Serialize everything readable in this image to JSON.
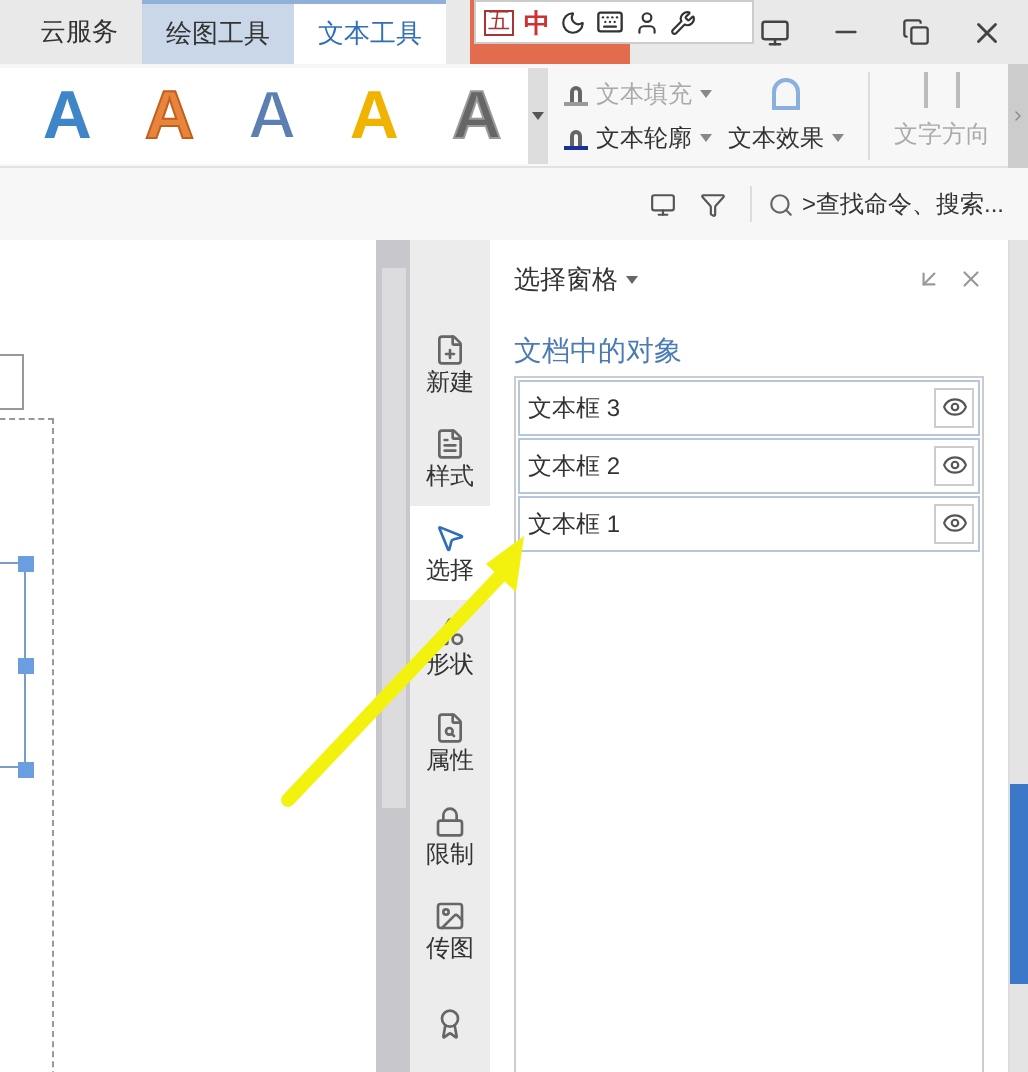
{
  "tabs": [
    {
      "label": "云服务",
      "kind": "plain",
      "selected": false
    },
    {
      "label": "绘图工具",
      "kind": "context",
      "selected": false
    },
    {
      "label": "文本工具",
      "kind": "context",
      "selected": true
    }
  ],
  "ime": {
    "mode_box": "五",
    "language": "中"
  },
  "style_presets": [
    {
      "letter": "A",
      "color": "#3f86c8",
      "kind": "solid"
    },
    {
      "letter": "A",
      "color": "#e8843c",
      "kind": "outlined"
    },
    {
      "letter": "A",
      "color": "#5b7fb0",
      "kind": "hollow"
    },
    {
      "letter": "A",
      "color": "#f0b400",
      "kind": "solid"
    },
    {
      "letter": "A",
      "color": "#666666",
      "kind": "gradient"
    }
  ],
  "ribbon_commands": [
    {
      "label": "文本填充",
      "disabled": true,
      "dropdown": true
    },
    {
      "label": "文本轮廓",
      "disabled": false,
      "dropdown": true
    },
    {
      "label": "文本效果",
      "disabled": false,
      "dropdown": true
    },
    {
      "label": "文字方向",
      "disabled": true
    }
  ],
  "search": {
    "placeholder": ">查找命令、搜索..."
  },
  "sidebar": {
    "items": [
      {
        "label": "新建",
        "selected": false
      },
      {
        "label": "样式",
        "selected": false
      },
      {
        "label": "选择",
        "selected": true
      },
      {
        "label": "形状",
        "selected": false
      },
      {
        "label": "属性",
        "selected": false
      },
      {
        "label": "限制",
        "selected": false
      },
      {
        "label": "传图",
        "selected": false
      },
      {
        "selected": false
      }
    ]
  },
  "pane": {
    "title": "选择窗格",
    "heading": "文档中的对象",
    "objects": [
      {
        "name": "文本框 3",
        "visible": true
      },
      {
        "name": "文本框 2",
        "visible": true
      },
      {
        "name": "文本框 1",
        "visible": true
      }
    ]
  }
}
